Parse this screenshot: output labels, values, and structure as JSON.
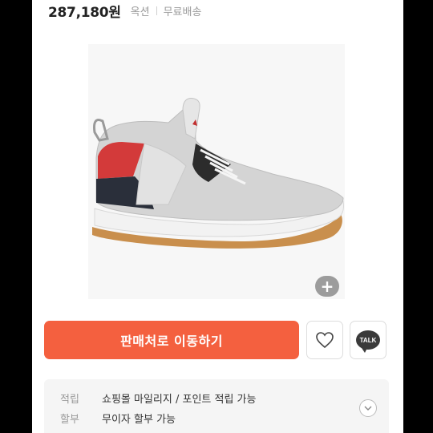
{
  "product": {
    "price": "287,180원",
    "option": "옥션",
    "shipping": "무료배송"
  },
  "image": {
    "zoom_label": "+"
  },
  "actions": {
    "buy_label": "판매처로 이동하기",
    "kakao_label": "TALK"
  },
  "benefits": [
    {
      "label": "적립",
      "value": "쇼핑몰 마일리지 / 포인트 적립 가능"
    },
    {
      "label": "할부",
      "value": "무이자 할부 가능"
    }
  ],
  "colors": {
    "accent": "#f4603f"
  },
  "icons": [
    "plus-icon",
    "heart-icon",
    "kakao-talk-icon",
    "chevron-down-icon"
  ]
}
